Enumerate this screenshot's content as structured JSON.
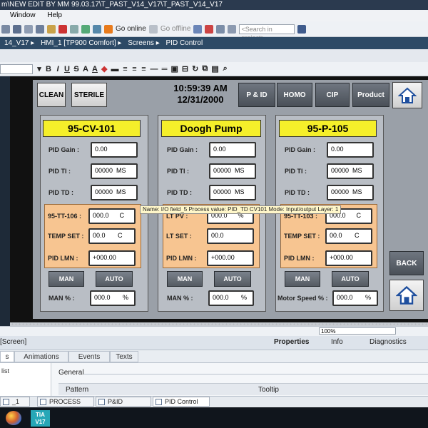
{
  "window": {
    "title": "m\\NEW EDIT BY MM 99.03.17\\T_PAST_V14_V17\\T_PAST_V14_V17"
  },
  "menu": [
    "Window",
    "Help"
  ],
  "toolbar": {
    "go_online": "Go online",
    "go_offline": "Go offline",
    "search_placeholder": "<Search in project>"
  },
  "breadcrumb": [
    "14_V17",
    "HMI_1 [TP900 Comfort]",
    "Screens",
    "PID Control"
  ],
  "hmi": {
    "top_buttons": {
      "clean": "CLEAN",
      "sterile": "STERILE",
      "pid": "P & ID",
      "homo": "HOMO",
      "cip": "CIP",
      "product": "Product"
    },
    "time": "10:59:39 AM",
    "date": "12/31/2000",
    "back": "BACK",
    "panels": [
      {
        "name": "95-CV-101",
        "pid_gain_label": "PID Gain :",
        "pid_gain": "0.00",
        "pid_ti_label": "PID TI :",
        "pid_ti": "00000  MS",
        "pid_td_label": "PID TD :",
        "pid_td": "00000  MS",
        "pv_label": "95-TT-106 :",
        "pv": "000.0      C",
        "set_label": "TEMP SET :",
        "set": "00.0       C",
        "lmn_label": "PID LMN :",
        "lmn": "+000.00",
        "man": "MAN",
        "auto": "AUTO",
        "out_label": "MAN  % :",
        "out": "000.0       %"
      },
      {
        "name": "Doogh Pump",
        "pid_gain_label": "PID Gain :",
        "pid_gain": "0.00",
        "pid_ti_label": "PID TI :",
        "pid_ti": "00000  MS",
        "pid_td_label": "PID TD :",
        "pid_td": "00000  MS",
        "pv_label": "LT PV :",
        "pv": "000.0      %",
        "set_label": "LT SET :",
        "set": "00.0",
        "lmn_label": "PID LMN :",
        "lmn": "+000.00",
        "man": "MAN",
        "auto": "AUTO",
        "out_label": "MAN  % :",
        "out": "000.0       %"
      },
      {
        "name": "95-P-105",
        "pid_gain_label": "PID Gain :",
        "pid_gain": "0.00",
        "pid_ti_label": "PID TI :",
        "pid_ti": "00000  MS",
        "pid_td_label": "PID TD :",
        "pid_td": "00000  MS",
        "pv_label": "95-TT-103 :",
        "pv": "000.0      C",
        "set_label": "TEMP SET :",
        "set": "00.0       C",
        "lmn_label": "PID LMN :",
        "lmn": "+000.00",
        "man": "MAN",
        "auto": "AUTO",
        "out_label": "Motor Speed % :",
        "out": "000.0       %"
      }
    ],
    "tooltip": "Name: I/O field_5  Process value: PID_TD CV101  Mode: Input/output  Layer: 1"
  },
  "zoom": "100%",
  "inspector": {
    "title": "[Screen]",
    "tabs": {
      "properties": "Properties",
      "info": "Info",
      "diagnostics": "Diagnostics"
    },
    "subtabs": [
      "s",
      "Animations",
      "Events",
      "Texts"
    ],
    "list_label": "list",
    "general": "General",
    "col_pattern": "Pattern",
    "col_tooltip": "Tooltip"
  },
  "editor_tabs": [
    "_1",
    "PROCESS",
    "P&ID",
    "PID Control"
  ],
  "taskbar": {
    "tia_line1": "TIA",
    "tia_line2": "V17"
  },
  "colors": {
    "tag_yellow": "#f5ef2a",
    "orange_group": "#f7c591",
    "header_blue": "#2d4a66"
  }
}
